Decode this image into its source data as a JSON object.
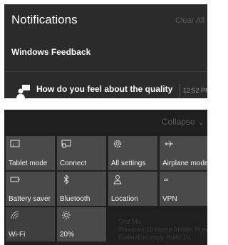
{
  "notifications": {
    "title": "Notifications",
    "clear_all": "Clear All",
    "app_name": "Windows Feedback",
    "item": {
      "icon": "feedback-person-icon",
      "text": "How do you feel about the quality",
      "time": "12:52 PM"
    }
  },
  "action_center": {
    "collapse_label": "Collapse",
    "tiles": [
      {
        "label": "Tablet mode",
        "icon": "tablet-icon"
      },
      {
        "label": "Connect",
        "icon": "connect-icon"
      },
      {
        "label": "All settings",
        "icon": "gear-icon"
      },
      {
        "label": "Airplane mode",
        "icon": "airplane-icon"
      },
      {
        "label": "Battery saver",
        "icon": "battery-icon"
      },
      {
        "label": "Bluetooth",
        "icon": "bluetooth-icon"
      },
      {
        "label": "Location",
        "icon": "location-icon"
      },
      {
        "label": "VPN",
        "icon": "vpn-icon"
      },
      {
        "label": "Wi-Fi",
        "icon": "wifi-icon"
      },
      {
        "label": "20%",
        "icon": "brightness-icon"
      }
    ]
  },
  "colors": {
    "panel_bg": "#2b2b2b",
    "tile_bg": "#4a4a4a",
    "text": "#ffffff"
  }
}
